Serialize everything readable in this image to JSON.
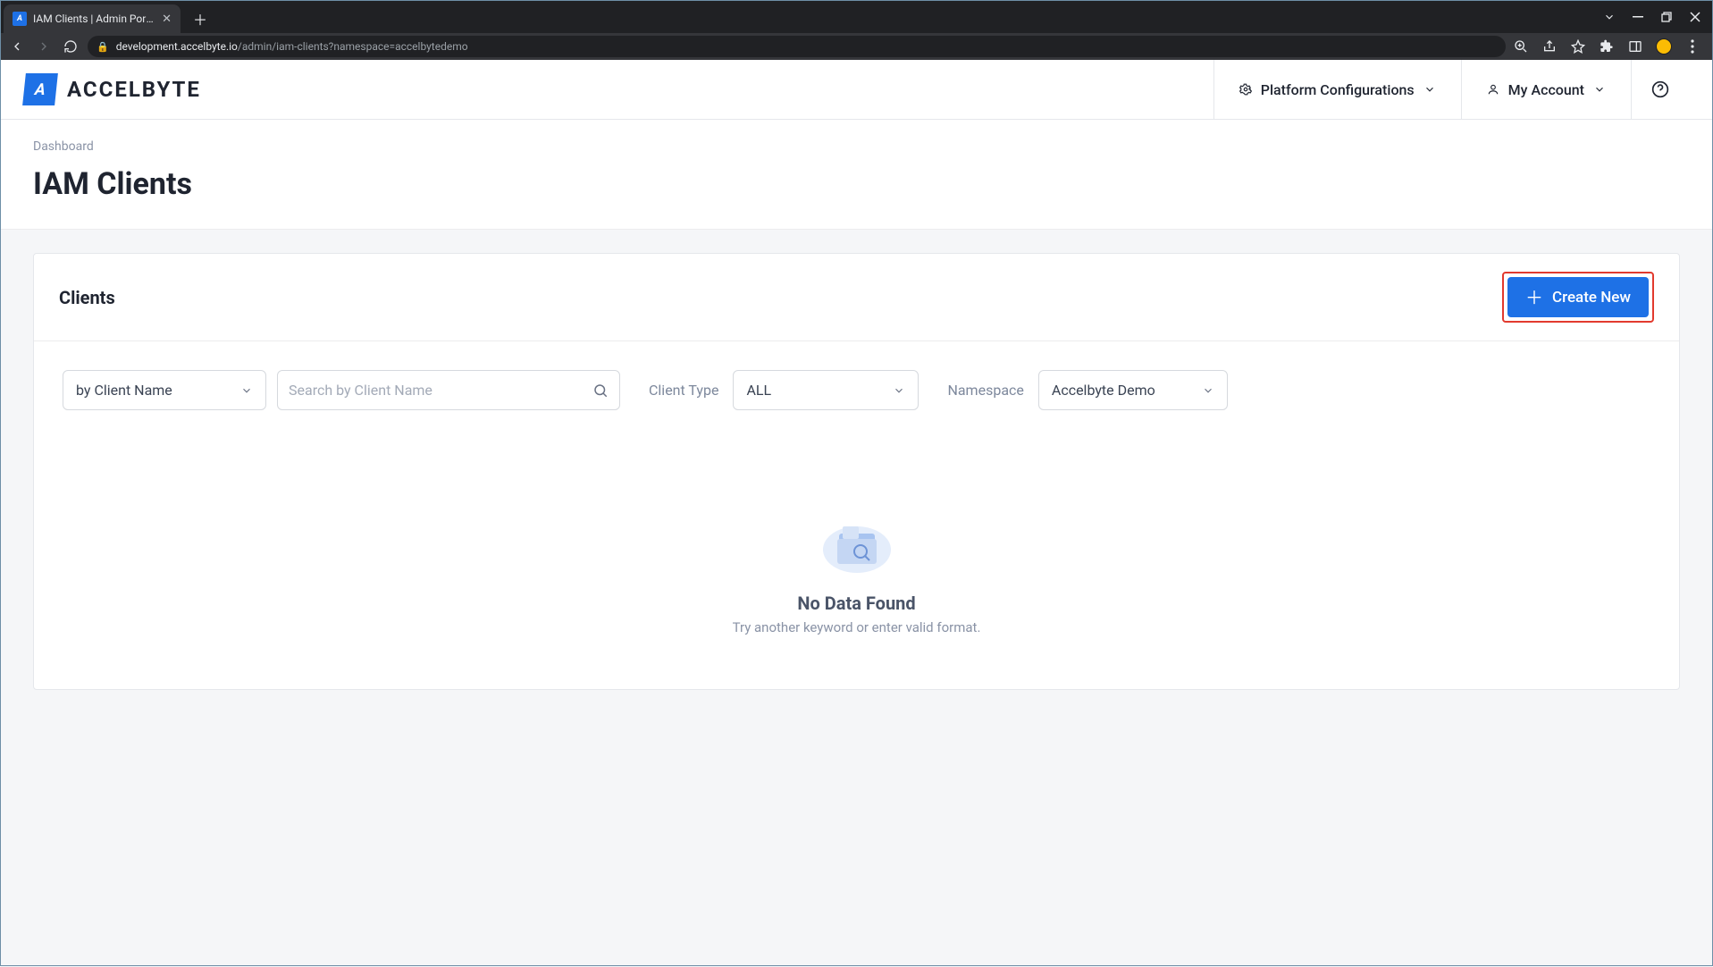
{
  "browser": {
    "tab_title": "IAM Clients | Admin Portal",
    "url_host": "development.accelbyte.io",
    "url_path": "/admin/iam-clients?namespace=accelbytedemo"
  },
  "header": {
    "brand_text": "ACCELBYTE",
    "platform_config": "Platform Configurations",
    "my_account": "My Account"
  },
  "subheader": {
    "breadcrumb": "Dashboard",
    "title": "IAM Clients"
  },
  "card": {
    "title": "Clients",
    "create_label": "Create New"
  },
  "filters": {
    "search_by_label": "by Client Name",
    "search_placeholder": "Search by Client Name",
    "client_type_label": "Client Type",
    "client_type_value": "ALL",
    "namespace_label": "Namespace",
    "namespace_value": "Accelbyte Demo"
  },
  "empty": {
    "title": "No Data Found",
    "subtitle": "Try another keyword or enter valid format."
  }
}
